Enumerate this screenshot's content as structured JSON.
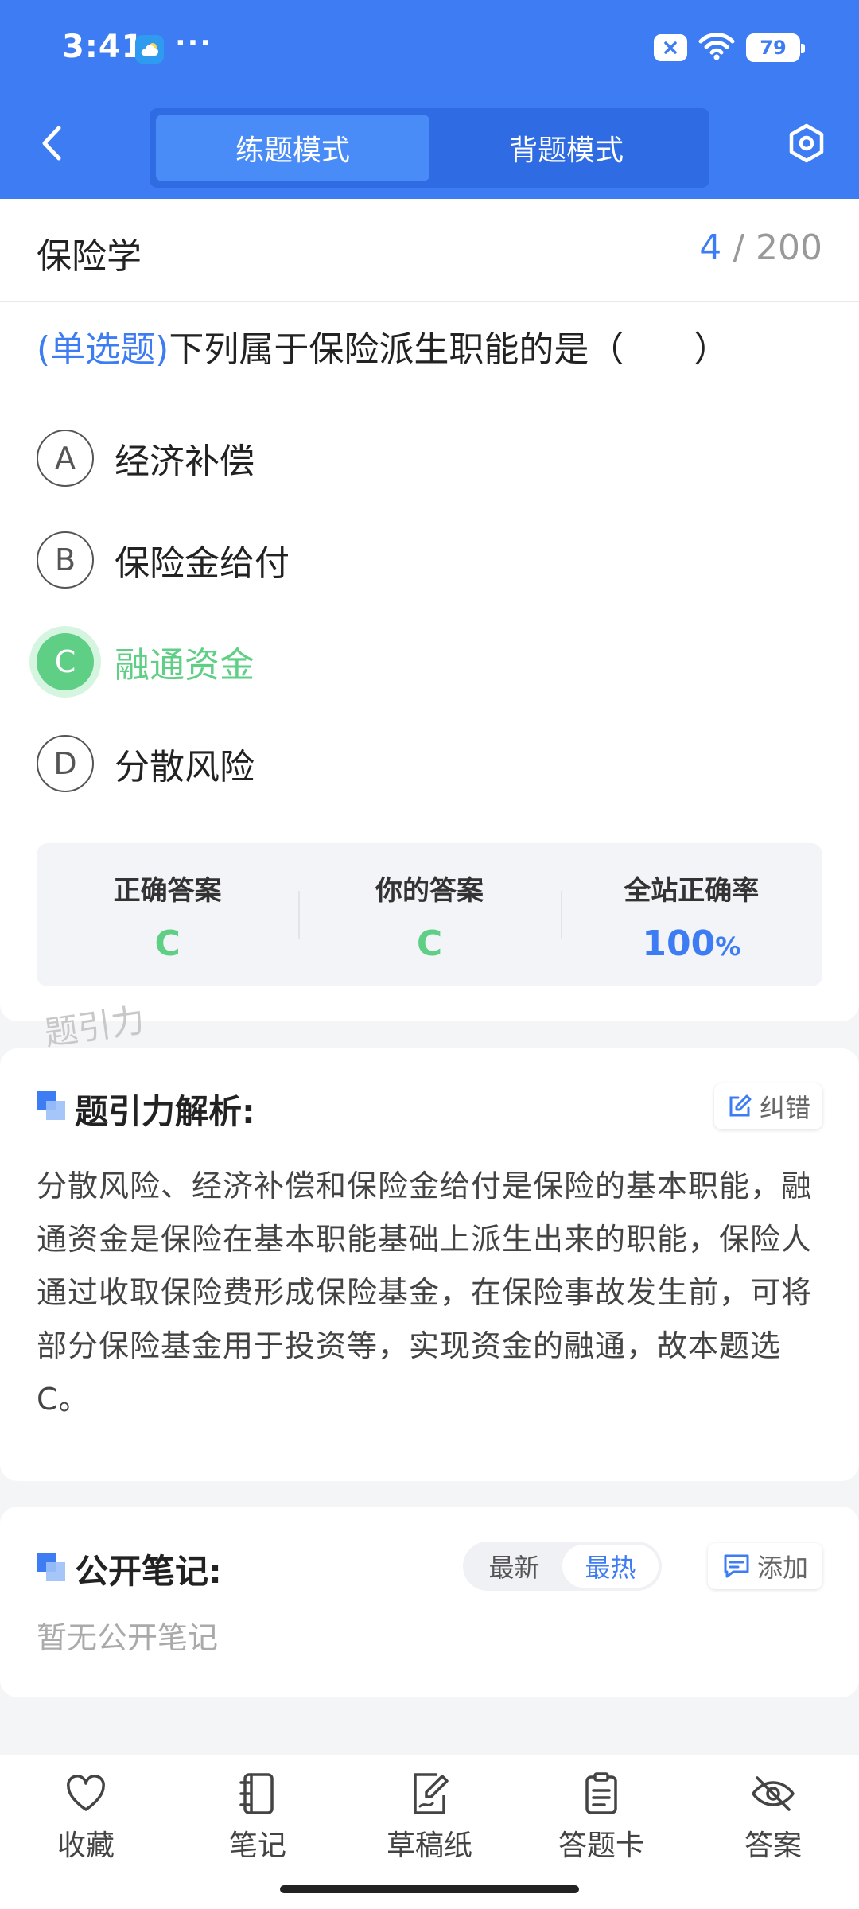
{
  "status_bar": {
    "time": "3:41",
    "dots": "···",
    "battery": "79"
  },
  "header": {
    "tabs": [
      {
        "label": "练题模式",
        "active": true
      },
      {
        "label": "背题模式",
        "active": false
      }
    ]
  },
  "question": {
    "subject": "保险学",
    "current": "4",
    "total": "/ 200",
    "type_label": "(单选题)",
    "text": "下列属于保险派生职能的是（　　）",
    "options": [
      {
        "letter": "A",
        "text": "经济补偿",
        "state": "normal"
      },
      {
        "letter": "B",
        "text": "保险金给付",
        "state": "normal"
      },
      {
        "letter": "C",
        "text": "融通资金",
        "state": "correct"
      },
      {
        "letter": "D",
        "text": "分散风险",
        "state": "normal"
      }
    ]
  },
  "stats": {
    "correct_label": "正确答案",
    "correct_value": "C",
    "yours_label": "你的答案",
    "yours_value": "C",
    "rate_label": "全站正确率",
    "rate_value": "100",
    "rate_unit": "%"
  },
  "watermark": "题引力",
  "analysis": {
    "title": "题引力解析:",
    "report_label": "纠错",
    "text": "分散风险、经济补偿和保险金给付是保险的基本职能，融通资金是保险在基本职能基础上派生出来的职能，保险人通过收取保险费形成保险基金，在保险事故发生前，可将部分保险基金用于投资等，实现资金的融通，故本题选 C。"
  },
  "notes": {
    "title": "公开笔记:",
    "sort_options": [
      {
        "label": "最新",
        "active": false
      },
      {
        "label": "最热",
        "active": true
      }
    ],
    "add_label": "添加",
    "empty_text": "暂无公开笔记"
  },
  "bottom_nav": [
    {
      "label": "收藏",
      "icon": "heart-icon"
    },
    {
      "label": "笔记",
      "icon": "notebook-icon"
    },
    {
      "label": "草稿纸",
      "icon": "draft-icon"
    },
    {
      "label": "答题卡",
      "icon": "clipboard-icon"
    },
    {
      "label": "答案",
      "icon": "eye-off-icon"
    }
  ],
  "colors": {
    "primary": "#3d7cf2",
    "correct": "#5ecf84"
  }
}
